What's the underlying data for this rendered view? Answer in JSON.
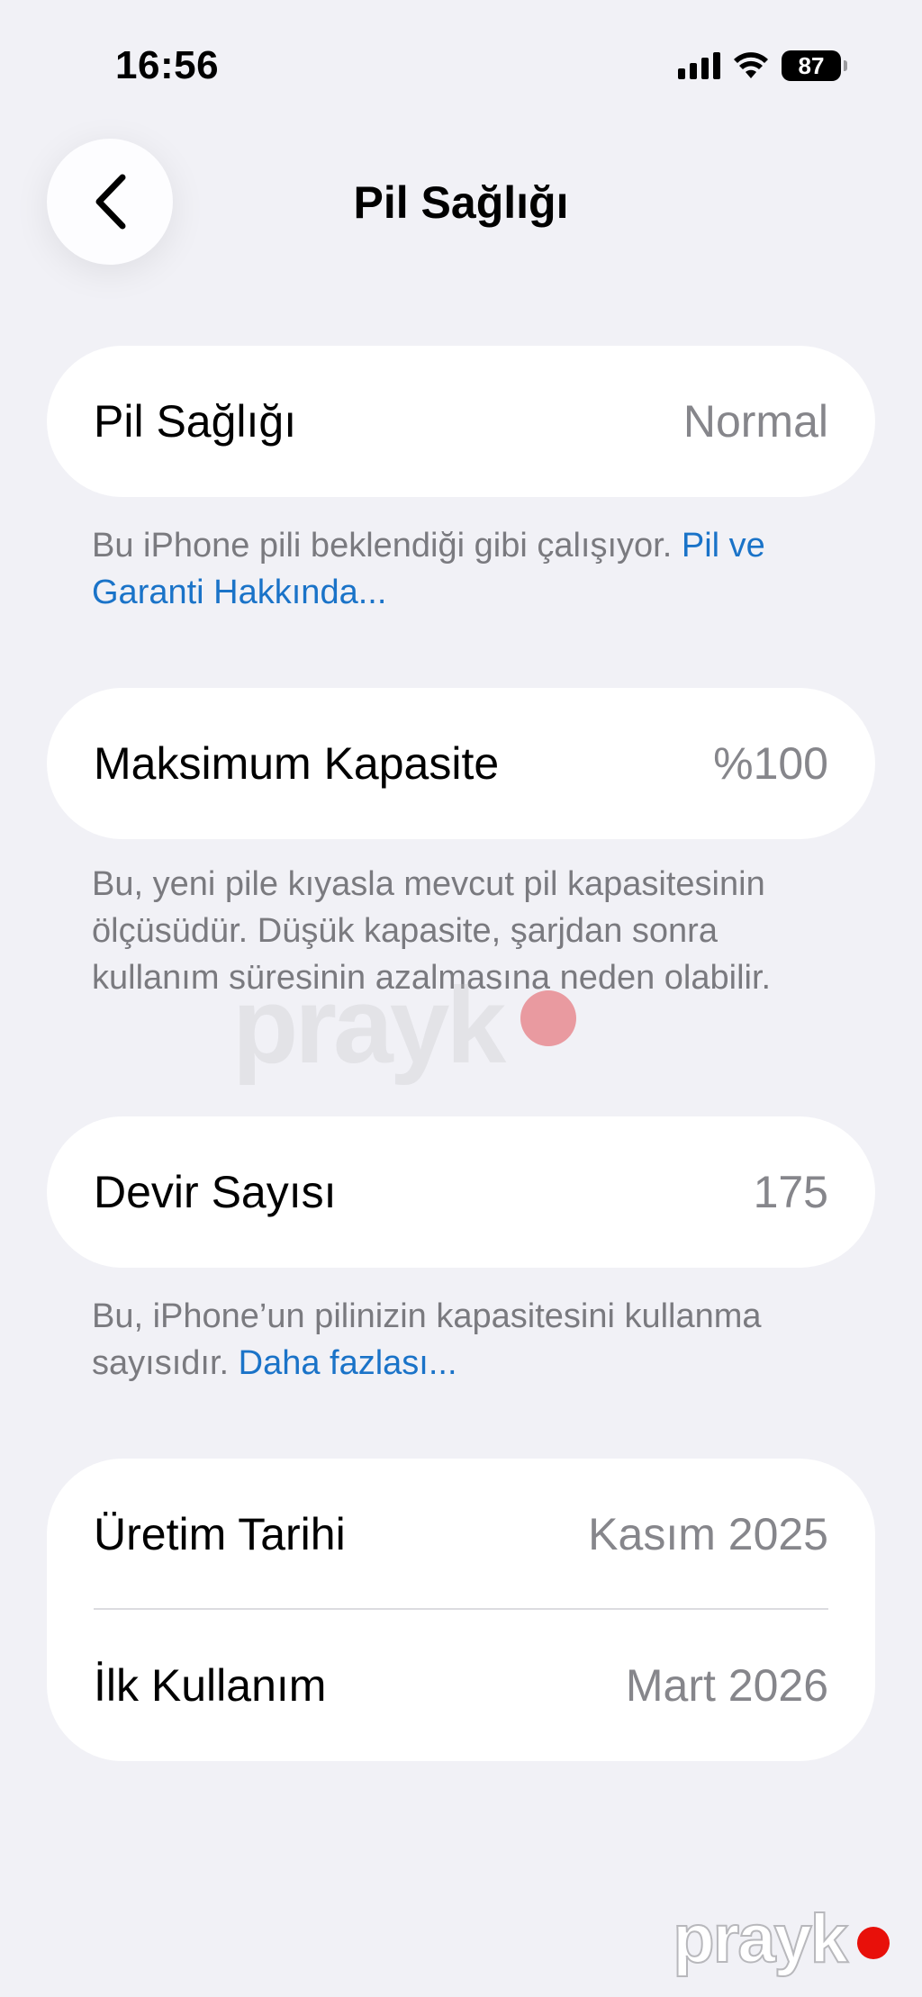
{
  "status_bar": {
    "time": "16:56",
    "battery_level": "87",
    "icons": [
      "signal-icon",
      "wifi-icon",
      "battery-icon"
    ]
  },
  "nav": {
    "title": "Pil Sağlığı",
    "back_icon": "chevron-left-icon"
  },
  "battery_health": {
    "label": "Pil Sağlığı",
    "value": "Normal",
    "note_text": "Bu iPhone pili beklendiği gibi çalışıyor. ",
    "note_link": "Pil ve Garanti Hakkında..."
  },
  "max_capacity": {
    "label": "Maksimum Kapasite",
    "value": "%100",
    "note_text": "Bu, yeni pile kıyasla mevcut pil kapasitesinin ölçüsüdür. Düşük kapasite, şarjdan sonra kullanım süresinin azalmasına neden olabilir."
  },
  "cycle_count": {
    "label": "Devir Sayısı",
    "value": "175",
    "note_text": "Bu, iPhone’un pilinizin kapasitesini kullanma sayısıdır. ",
    "note_link": "Daha fazlası..."
  },
  "dates": {
    "manufacture_label": "Üretim Tarihi",
    "manufacture_value": "Kasım 2025",
    "first_use_label": "İlk Kullanım",
    "first_use_value": "Mart 2026"
  },
  "watermark": {
    "text": "prayk"
  },
  "colors": {
    "background": "#f1f1f6",
    "card": "#ffffff",
    "link": "#1a73c8",
    "secondary_text": "#86868b"
  }
}
